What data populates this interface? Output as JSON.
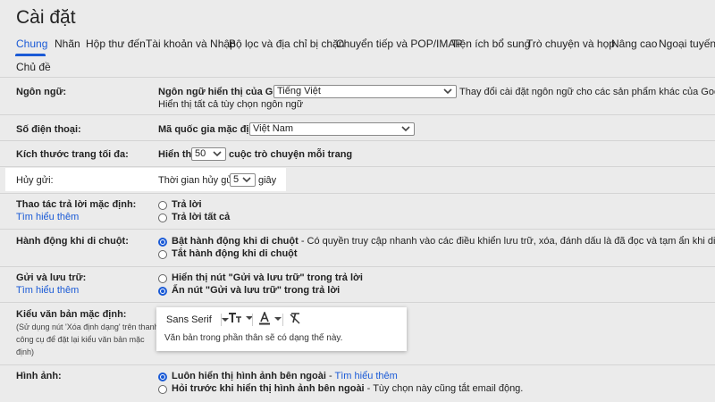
{
  "header": {
    "title": "Cài đặt"
  },
  "tabs": [
    {
      "label": "Chung"
    },
    {
      "label": "Nhãn"
    },
    {
      "label": "Hộp thư đến"
    },
    {
      "label": "Tài khoản và Nhập"
    },
    {
      "label": "Bộ lọc và địa chỉ bị chặn"
    },
    {
      "label": "Chuyển tiếp và POP/IMAP"
    },
    {
      "label": "Tiện ích bổ sung"
    },
    {
      "label": "Trò chuyện và họp"
    },
    {
      "label": "Nâng cao"
    },
    {
      "label": "Ngoại tuyến"
    },
    {
      "label": "Chủ đề"
    }
  ],
  "accent_color": "#1a5ad6",
  "language": {
    "label": "Ngôn ngữ:",
    "display_label": "Ngôn ngữ hiển thị của Gmail:",
    "value": "Tiếng Việt",
    "change_link": "Thay đổi cài đặt ngôn ngữ cho các sản phẩm khác của Google",
    "all_options_link": "Hiển thị tất cả tùy chọn ngôn ngữ"
  },
  "phone": {
    "label": "Số điện thoại:",
    "code_label": "Mã quốc gia mặc định:",
    "value": "Việt Nam"
  },
  "page_size": {
    "label": "Kích thước trang tối đa:",
    "prefix": "Hiển thị",
    "value": "50",
    "suffix": "cuộc trò chuyện mỗi trang"
  },
  "undo_send": {
    "label": "Hủy gửi:",
    "period_label": "Thời gian hủy gửi:",
    "value": "5",
    "unit": "giây"
  },
  "reply": {
    "label": "Thao tác trả lời mặc định:",
    "learn_more": "Tìm hiểu thêm",
    "options": [
      "Trả lời",
      "Trả lời tất cả"
    ],
    "selected_index": -1
  },
  "hover": {
    "label": "Hành động khi di chuột:",
    "on_label": "Bật hành động khi di chuột",
    "on_desc": " - Có quyền truy cập nhanh vào các điều khiển lưu trữ, xóa, đánh dấu là đã đọc và tạm ẩn khi di chuột.",
    "off_label": "Tắt hành động khi di chuột",
    "selected_index": 0
  },
  "send_archive": {
    "label": "Gửi và lưu trữ:",
    "learn_more": "Tìm hiểu thêm",
    "options": [
      "Hiển thị nút \"Gửi và lưu trữ\" trong trả lời",
      "Ẩn nút \"Gửi và lưu trữ\" trong trả lời"
    ],
    "selected_index": 1
  },
  "text_style": {
    "label": "Kiểu văn bản mặc định:",
    "note": [
      "(Sử dụng nút 'Xóa định dạng' trên thanh",
      "công cụ để đặt lại kiểu văn bản mặc",
      "định)"
    ],
    "font": "Sans Serif",
    "preview": "Văn bản trong phần thân sẽ có dạng thế này."
  },
  "images": {
    "label": "Hình ảnh:",
    "opt1": "Luôn hiển thị hình ảnh bên ngoài",
    "opt1_sep": " - ",
    "opt1_link": "Tìm hiểu thêm",
    "opt2": "Hỏi trước khi hiển thị hình ảnh bên ngoài",
    "opt2_desc": " - Tùy chọn này cũng tắt email động.",
    "selected_index": 0
  }
}
